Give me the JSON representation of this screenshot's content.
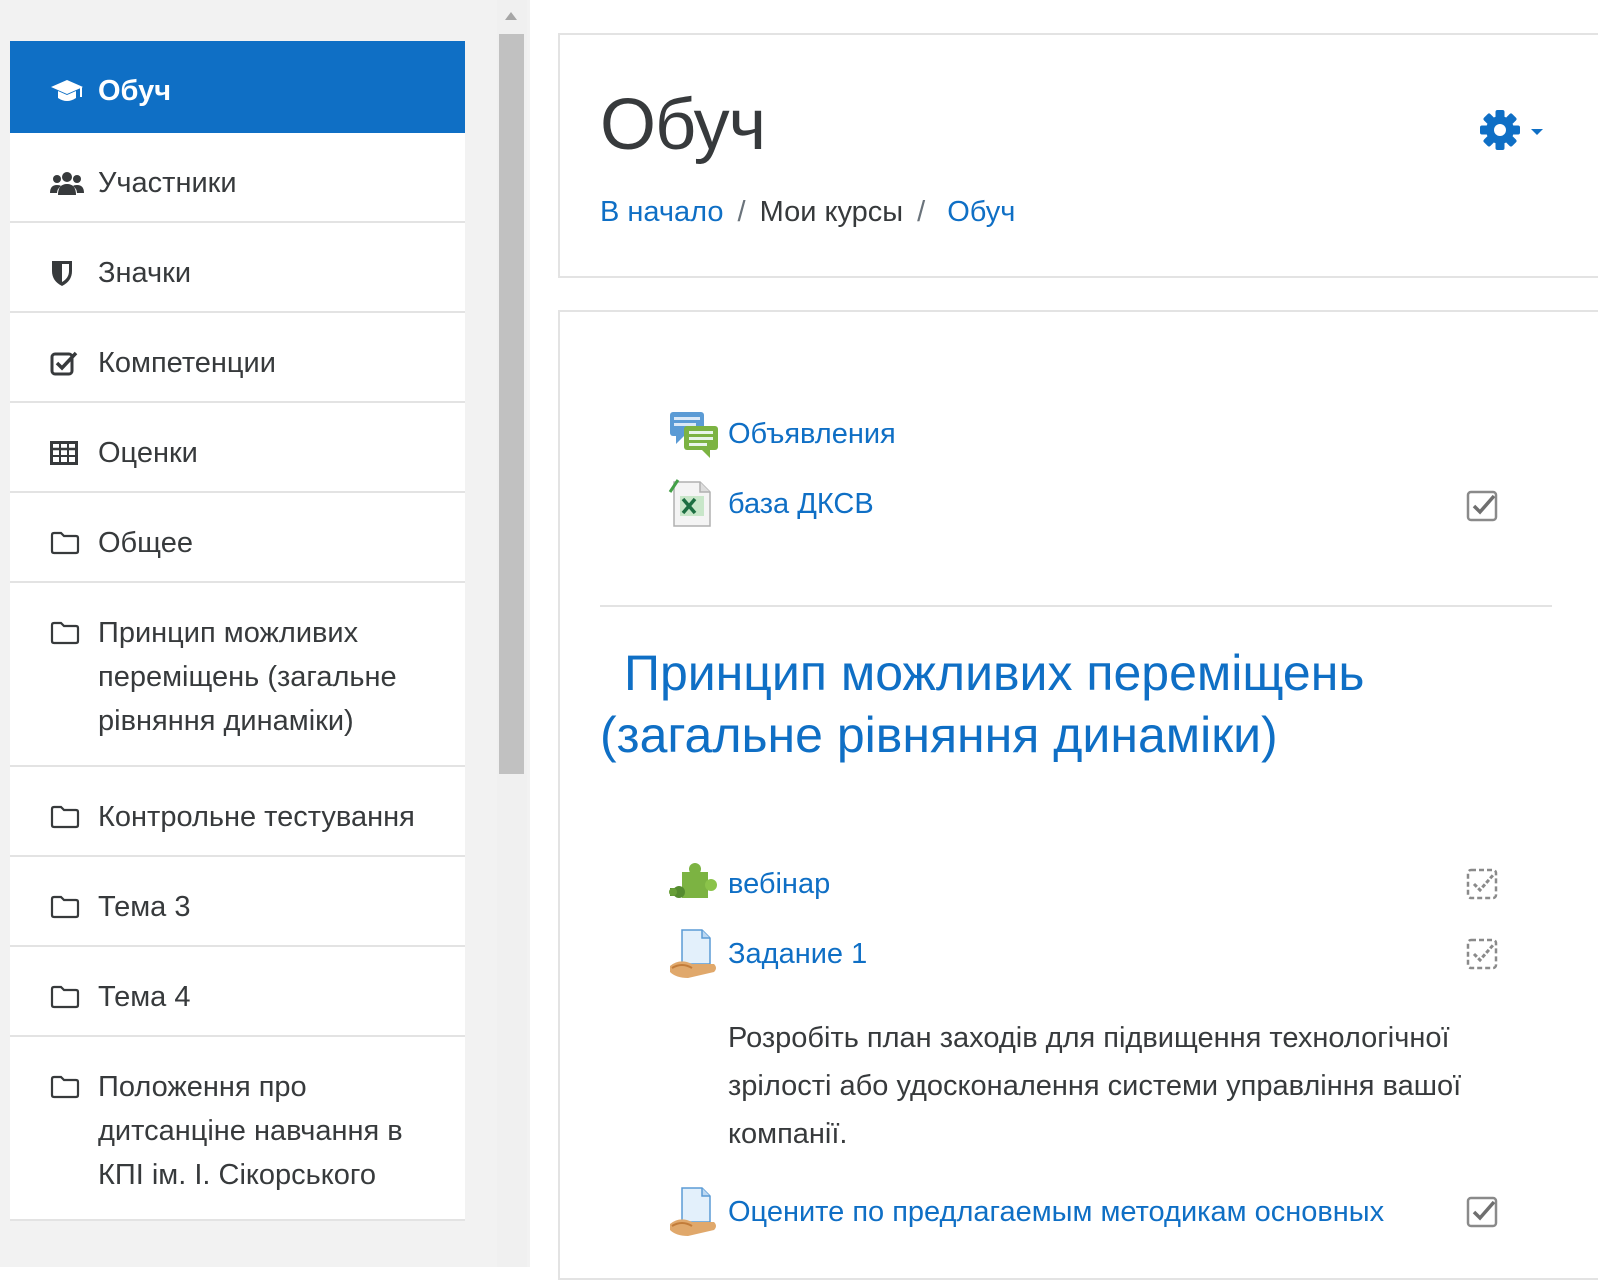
{
  "drawer": {
    "items": [
      {
        "label": "Обуч",
        "icon": "graduation-cap-icon",
        "active": true
      },
      {
        "label": "Участники",
        "icon": "users-icon"
      },
      {
        "label": "Значки",
        "icon": "shield-icon"
      },
      {
        "label": "Компетенции",
        "icon": "check-square-icon"
      },
      {
        "label": "Оценки",
        "icon": "table-icon"
      },
      {
        "label": "Общее",
        "icon": "folder-icon"
      },
      {
        "label": "Принцип можливих переміщень (загальне рівняння динаміки)",
        "icon": "folder-icon"
      },
      {
        "label": "Контрольне тестування",
        "icon": "folder-icon"
      },
      {
        "label": "Тема 3",
        "icon": "folder-icon"
      },
      {
        "label": "Тема 4",
        "icon": "folder-icon"
      },
      {
        "label": "Положення про дитсанціне навчання в КПІ ім. І. Сікорського",
        "icon": "folder-icon"
      }
    ]
  },
  "header": {
    "title": "Обуч",
    "breadcrumb": {
      "home": "В начало",
      "my_courses": "Мои курсы",
      "current": "Обуч"
    }
  },
  "content": {
    "general_activities": [
      {
        "label": "Объявления",
        "icon": "forum-icon"
      },
      {
        "label": "база ДКСВ",
        "icon": "spreadsheet-file-icon",
        "completion": "manual-complete"
      }
    ],
    "section": {
      "title": "Принцип можливих переміщень (загальне рівняння динаміки)",
      "activities": [
        {
          "label": "вебінар",
          "icon": "puzzle-icon",
          "completion": "auto-incomplete"
        },
        {
          "label": "Задание 1",
          "icon": "assignment-icon",
          "completion": "auto-incomplete",
          "description": "Розробіть план заходів для підвищення технологічної зрілості або удосконалення системи управління вашої компанії."
        },
        {
          "label": "Оцените по предлагаемым методикам основных",
          "icon": "assignment-icon",
          "completion": "manual-complete"
        }
      ]
    }
  },
  "colors": {
    "accent": "#0f6fc5",
    "text": "#373a3c",
    "border": "#e3e3e3"
  }
}
